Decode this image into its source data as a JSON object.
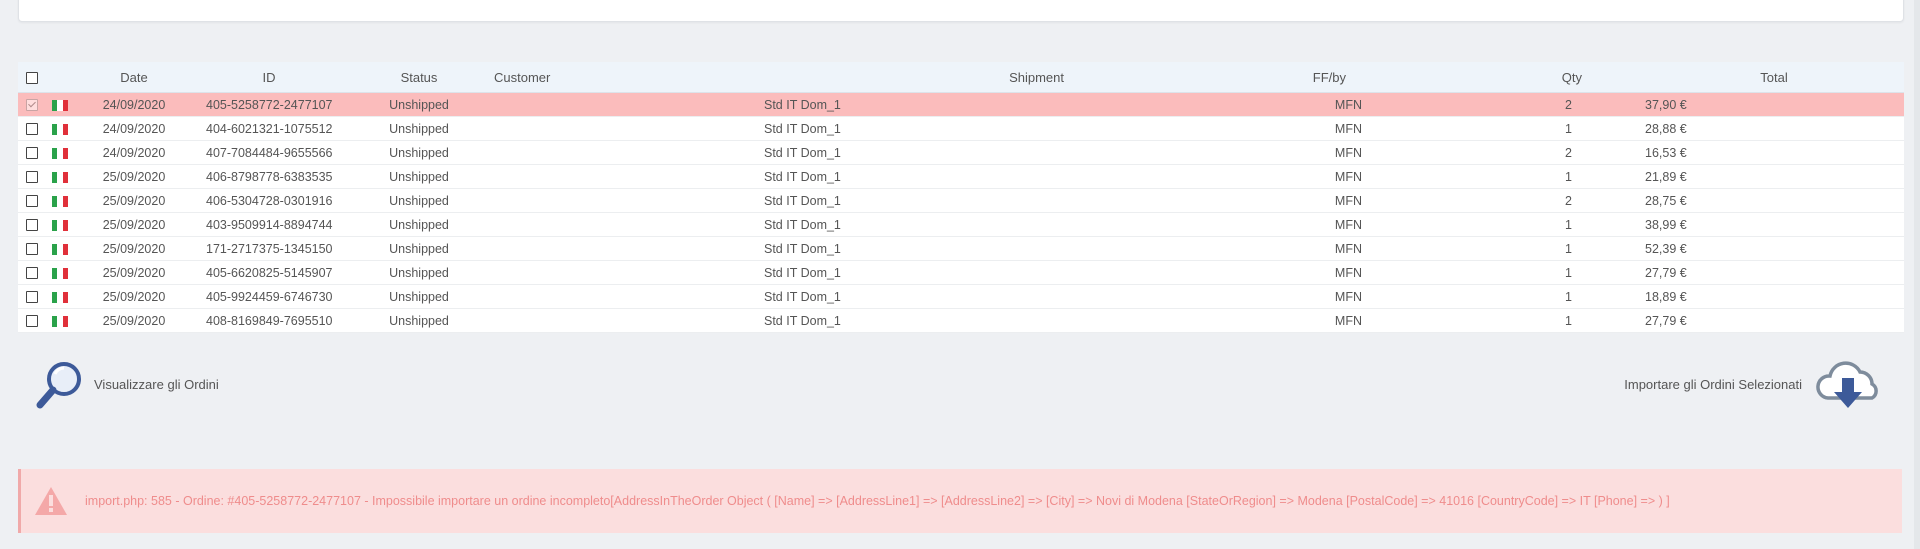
{
  "table": {
    "headers": {
      "date": "Date",
      "id": "ID",
      "status": "Status",
      "customer": "Customer",
      "shipment": "Shipment",
      "ffby": "FF/by",
      "qty": "Qty",
      "total": "Total"
    },
    "rows": [
      {
        "selected": true,
        "date": "24/09/2020",
        "id": "405-5258772-2477107",
        "status": "Unshipped",
        "customer": "",
        "shipment": "Std IT Dom_1",
        "ffby": "MFN",
        "qty": "2",
        "total": "37,90 €"
      },
      {
        "selected": false,
        "date": "24/09/2020",
        "id": "404-6021321-1075512",
        "status": "Unshipped",
        "customer": "",
        "shipment": "Std IT Dom_1",
        "ffby": "MFN",
        "qty": "1",
        "total": "28,88 €"
      },
      {
        "selected": false,
        "date": "24/09/2020",
        "id": "407-7084484-9655566",
        "status": "Unshipped",
        "customer": "",
        "shipment": "Std IT Dom_1",
        "ffby": "MFN",
        "qty": "2",
        "total": "16,53 €"
      },
      {
        "selected": false,
        "date": "25/09/2020",
        "id": "406-8798778-6383535",
        "status": "Unshipped",
        "customer": "",
        "shipment": "Std IT Dom_1",
        "ffby": "MFN",
        "qty": "1",
        "total": "21,89 €"
      },
      {
        "selected": false,
        "date": "25/09/2020",
        "id": "406-5304728-0301916",
        "status": "Unshipped",
        "customer": "",
        "shipment": "Std IT Dom_1",
        "ffby": "MFN",
        "qty": "2",
        "total": "28,75 €"
      },
      {
        "selected": false,
        "date": "25/09/2020",
        "id": "403-9509914-8894744",
        "status": "Unshipped",
        "customer": "",
        "shipment": "Std IT Dom_1",
        "ffby": "MFN",
        "qty": "1",
        "total": "38,99 €"
      },
      {
        "selected": false,
        "date": "25/09/2020",
        "id": "171-2717375-1345150",
        "status": "Unshipped",
        "customer": "",
        "shipment": "Std IT Dom_1",
        "ffby": "MFN",
        "qty": "1",
        "total": "52,39 €"
      },
      {
        "selected": false,
        "date": "25/09/2020",
        "id": "405-6620825-5145907",
        "status": "Unshipped",
        "customer": "",
        "shipment": "Std IT Dom_1",
        "ffby": "MFN",
        "qty": "1",
        "total": "27,79 €"
      },
      {
        "selected": false,
        "date": "25/09/2020",
        "id": "405-9924459-6746730",
        "status": "Unshipped",
        "customer": "",
        "shipment": "Std IT Dom_1",
        "ffby": "MFN",
        "qty": "1",
        "total": "18,89 €"
      },
      {
        "selected": false,
        "date": "25/09/2020",
        "id": "408-8169849-7695510",
        "status": "Unshipped",
        "customer": "",
        "shipment": "Std IT Dom_1",
        "ffby": "MFN",
        "qty": "1",
        "total": "27,79 €"
      }
    ]
  },
  "actions": {
    "view_label": "Visualizzare gli Ordini",
    "import_label": "Importare gli Ordini Selezionati"
  },
  "alert": {
    "message": "import.php: 585 - Ordine: #405-5258772-2477107 - Impossibile importare un ordine incompleto[AddressInTheOrder Object ( [Name] => [AddressLine1] => [AddressLine2] => [City] => Novi di Modena [StateOrRegion] => Modena [PostalCode] => 41016 [CountryCode] => IT [Phone] => ) ]"
  },
  "icons": {
    "view": "magnifier-icon",
    "import": "cloud-download-icon",
    "alert": "warning-icon",
    "flag": "italy-flag-icon"
  },
  "colors": {
    "selected_row": "#fbbcbc",
    "header_bg": "#eef4fa",
    "alert_bg": "#fbdede",
    "alert_text": "#ef8c8c",
    "icon_blue": "#3d5a99"
  }
}
